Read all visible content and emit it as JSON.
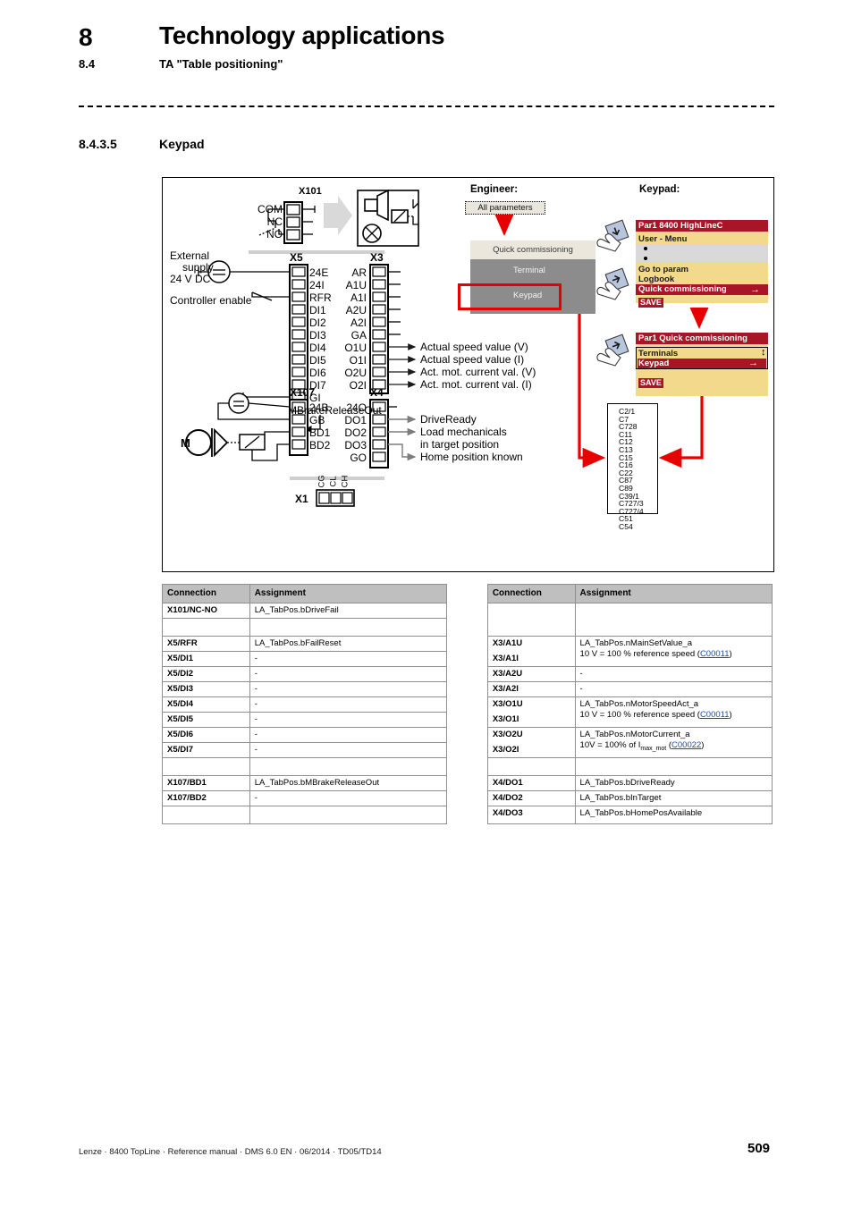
{
  "header": {
    "chapter_number": "8",
    "chapter_title": "Technology applications",
    "section_number": "8.4",
    "section_title": "TA \"Table positioning\"",
    "subsection_number": "8.4.3.5",
    "subsection_title": "Keypad"
  },
  "figure": {
    "terminals": {
      "x101": {
        "label": "X101",
        "pins": [
          "COM",
          "NC",
          "NO"
        ]
      },
      "x5": {
        "label": "X5",
        "pins": [
          "24E",
          "24I",
          "RFR",
          "DI1",
          "DI2",
          "DI3",
          "DI4",
          "DI5",
          "DI6",
          "DI7",
          "GI"
        ]
      },
      "x3": {
        "label": "X3",
        "pins": [
          "AR",
          "A1U",
          "A1I",
          "A2U",
          "A2I",
          "GA",
          "O1U",
          "O1I",
          "O2U",
          "O2I"
        ]
      },
      "x107": {
        "label": "X107",
        "pins": [
          "24B",
          "GB",
          "BD1",
          "BD2"
        ]
      },
      "x4": {
        "label": "X4",
        "pins": [
          "24O",
          "DO1",
          "DO2",
          "DO3",
          "GO"
        ]
      },
      "x1": {
        "label": "X1",
        "pins": [
          "CG",
          "CL",
          "CH"
        ]
      }
    },
    "left_labels": {
      "external_supply_line1": "External",
      "external_supply_line2": "supply",
      "external_supply_line3": "24 V DC",
      "controller_enable": "Controller enable",
      "motor": "M",
      "mbrake_release_out": "MBrakeReleaseOut"
    },
    "analog_outputs": [
      "Actual speed value (V)",
      "Actual speed value (I)",
      "Act. mot. current val. (V)",
      "Act. mot. current val. (I)"
    ],
    "digital_outputs": [
      "DriveReady",
      "Load mechanicals",
      "in target position",
      "Home position known"
    ],
    "engineer": {
      "title": "Engineer:",
      "all_parameters": "All parameters",
      "quick_commissioning_header": "Quick commissioning",
      "options": [
        {
          "label": "Terminal",
          "arrow_color": "#d4d4d4",
          "selected": false
        },
        {
          "label": "Keypad",
          "arrow_color": "#29b6e8",
          "selected": true
        }
      ]
    },
    "keypad": {
      "title": "Keypad:",
      "screen1": {
        "titlebar": "Par1 8400 HighLineC",
        "menu_label": "User - Menu",
        "items": [
          "Go to param",
          "Logbook"
        ],
        "highlighted": "Quick commissioning",
        "highlight_arrow": "→",
        "save": "SAVE"
      },
      "screen2": {
        "titlebar": "Par1 Quick commissioning",
        "items": [
          "Terminals"
        ],
        "highlighted": "Keypad",
        "highlight_arrow": "→",
        "save": "SAVE"
      }
    },
    "parameter_list": [
      "C2/1",
      "C7",
      "C728",
      "C11",
      "C12",
      "C13",
      "C15",
      "C16",
      "C22",
      "C87",
      "C89",
      "C39/1",
      "C727/3",
      "C727/4",
      "C51",
      "C54"
    ],
    "colors": {
      "accent_red": "#e60000",
      "keypad_bar": "#a81526",
      "keypad_bg": "#f2d98c",
      "engineer_panel": "#8c8c8c",
      "engineer_header": "#ece7dd",
      "link": "#1f4e9c"
    }
  },
  "table": {
    "headers": {
      "connection": "Connection",
      "assignment": "Assignment"
    },
    "left_rows": [
      {
        "connection": "X101/NC-NO",
        "assignment": "LA_TabPos.bDriveFail"
      },
      {
        "blank": true
      },
      {
        "connection": "X5/RFR",
        "assignment": "LA_TabPos.bFailReset"
      },
      {
        "connection": "X5/DI1",
        "assignment": "-"
      },
      {
        "connection": "X5/DI2",
        "assignment": "-"
      },
      {
        "connection": "X5/DI3",
        "assignment": "-"
      },
      {
        "connection": "X5/DI4",
        "assignment": "-"
      },
      {
        "connection": "X5/DI5",
        "assignment": "-"
      },
      {
        "connection": "X5/DI6",
        "assignment": "-"
      },
      {
        "connection": "X5/DI7",
        "assignment": "-"
      },
      {
        "blank": true
      },
      {
        "connection": "X107/BD1",
        "assignment": "LA_TabPos.bMBrakeReleaseOut"
      },
      {
        "connection": "X107/BD2",
        "assignment": "-"
      },
      {
        "blank": true
      }
    ],
    "right_rows": [
      {
        "blank": true,
        "tall": true
      },
      {
        "connection": "X3/A1U",
        "connection2": "X3/A1I",
        "assignment_line1": "LA_TabPos.nMainSetValue_a",
        "assignment_line2_pre": "10 V = 100 % reference speed (",
        "assignment_link": "C00011",
        "assignment_line2_post": ")",
        "merged": true
      },
      {
        "connection": "X3/A2U",
        "assignment": "-"
      },
      {
        "connection": "X3/A2I",
        "assignment": "-"
      },
      {
        "connection": "X3/O1U",
        "connection2": "X3/O1I",
        "assignment_line1": "LA_TabPos.nMotorSpeedAct_a",
        "assignment_line2_pre": "10 V = 100 % reference speed (",
        "assignment_link": "C00011",
        "assignment_line2_post": ")",
        "merged": true
      },
      {
        "connection": "X3/O2U",
        "connection2": "X3/O2I",
        "assignment_line1": "LA_TabPos.nMotorCurrent_a",
        "assignment_line2_pre": "10V = 100% of I",
        "assignment_line2_sub": "max_mot",
        "assignment_link": "C00022",
        "assignment_line2_post": ")",
        "assignment_line2_mid": " (",
        "merged": true
      },
      {
        "blank": true
      },
      {
        "connection": "X4/DO1",
        "assignment": "LA_TabPos.bDriveReady"
      },
      {
        "connection": "X4/DO2",
        "assignment": "LA_TabPos.bInTarget"
      },
      {
        "connection": "X4/DO3",
        "assignment": "LA_TabPos.bHomePosAvailable"
      }
    ]
  },
  "footer": {
    "text": "Lenze · 8400 TopLine · Reference manual · DMS 6.0 EN · 06/2014 · TD05/TD14",
    "page_number": "509"
  }
}
